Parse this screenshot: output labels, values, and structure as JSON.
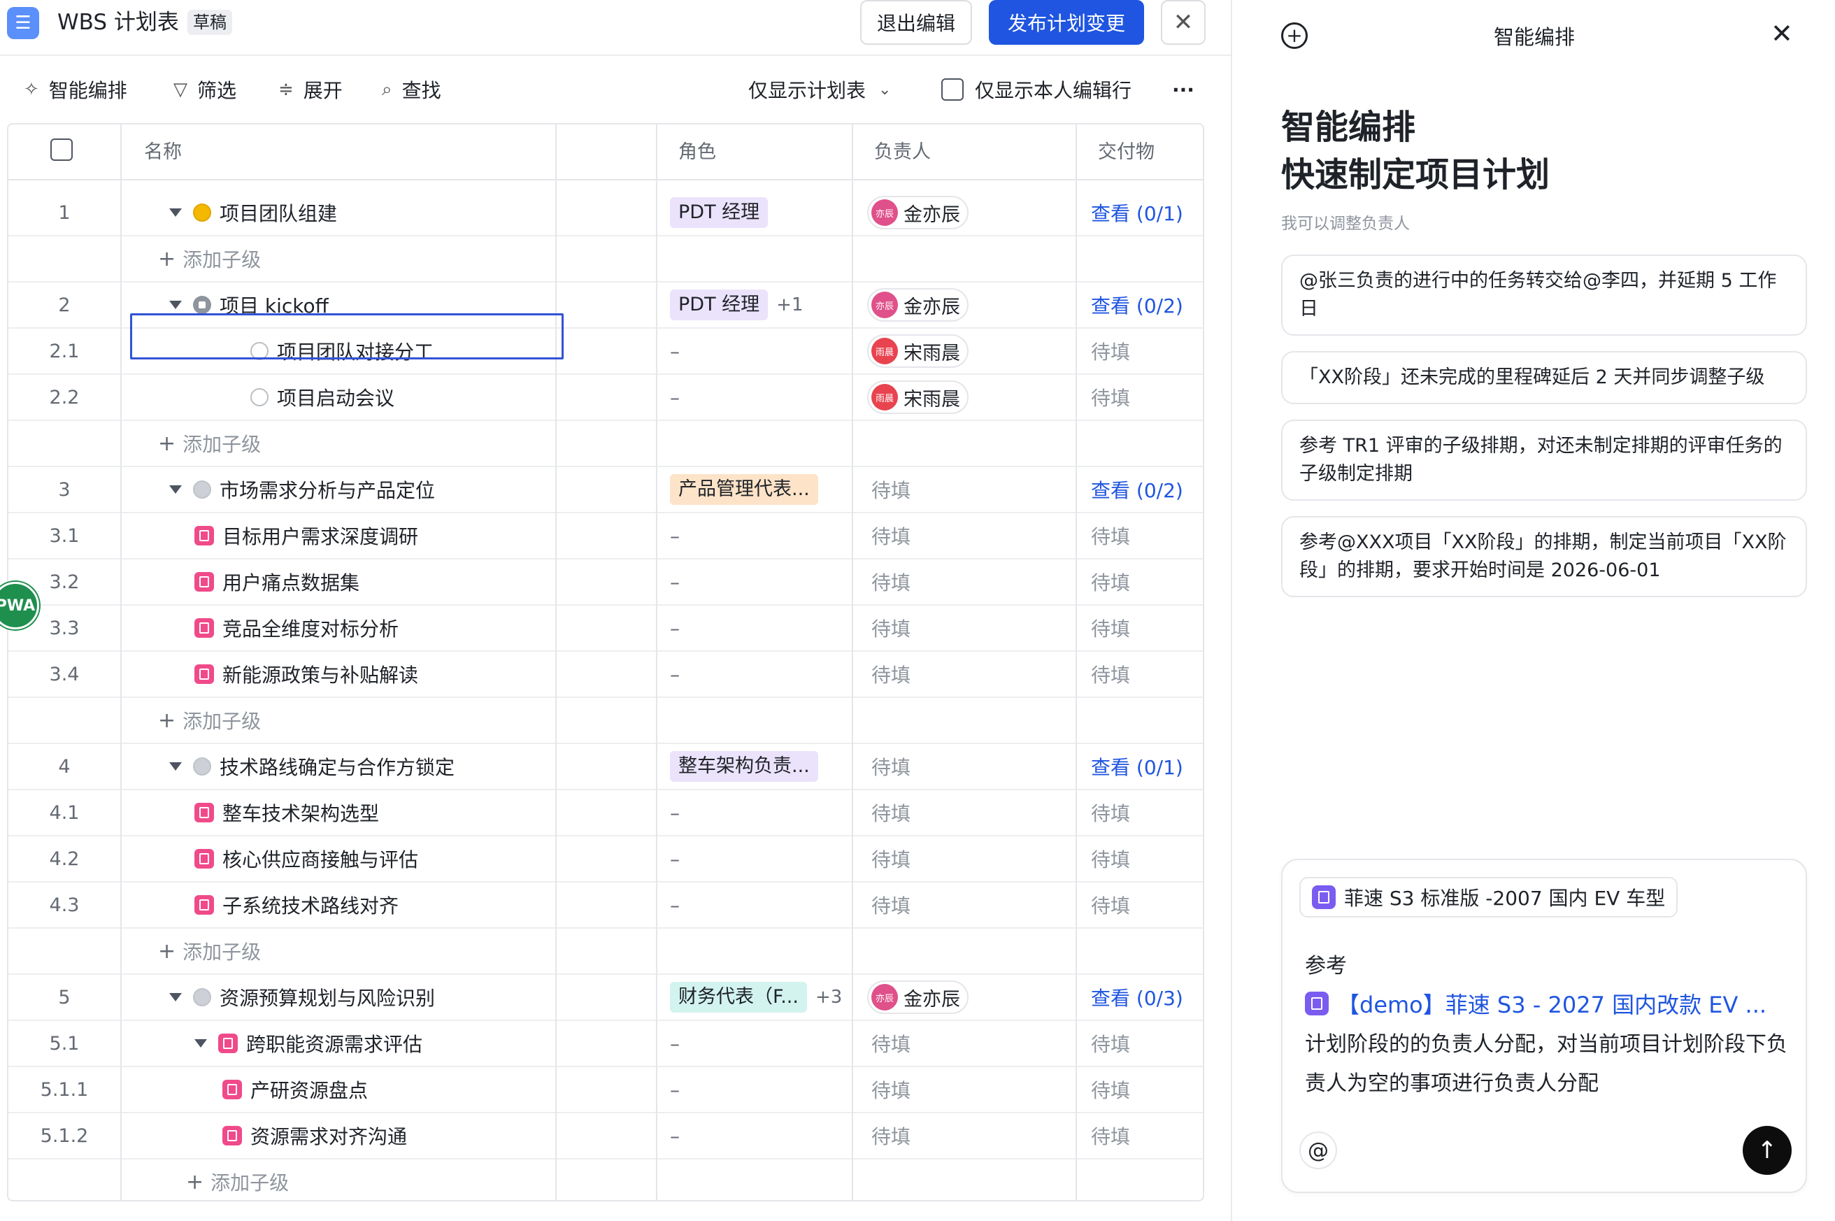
{
  "header": {
    "title": "WBS 计划表",
    "badge": "草稿",
    "exit_label": "退出编辑",
    "publish_label": "发布计划变更",
    "close_glyph": "✕"
  },
  "toolbar": {
    "smart": "智能编排",
    "filter": "筛选",
    "expand": "展开",
    "find": "查找",
    "plan_only": "仅显示计划表",
    "mine_only": "仅显示本人编辑行",
    "more": "···"
  },
  "columns": {
    "name": "名称",
    "role": "角色",
    "owner": "负责人",
    "deliverable": "交付物"
  },
  "add_child": "添加子级",
  "rows": [
    {
      "num": "1",
      "level": 0,
      "toggle": "down",
      "marker": "yellow",
      "name": "项目团队组建",
      "role": "PDT 经理",
      "role_color": "purple",
      "role_more": "",
      "owner": "金亦辰",
      "avatar": "亦辰",
      "deliv": "查看 (0/1)",
      "deliv_link": true
    },
    {
      "add": true,
      "indent": 1
    },
    {
      "num": "2",
      "level": 0,
      "toggle": "down",
      "marker": "flag",
      "name": "项目 kickoff",
      "role": "PDT 经理",
      "role_color": "purple",
      "role_more": "+1",
      "owner": "金亦辰",
      "avatar": "亦辰",
      "deliv": "查看 (0/2)",
      "deliv_link": true
    },
    {
      "num": "2.1",
      "level": 1,
      "toggle": "",
      "marker": "empty",
      "name": "项目团队对接分工",
      "role": "–",
      "owner": "宋雨晨",
      "avatar": "雨晨",
      "avatar_red": true,
      "deliv": "待填"
    },
    {
      "num": "2.2",
      "level": 1,
      "toggle": "",
      "marker": "empty",
      "name": "项目启动会议",
      "role": "–",
      "owner": "宋雨晨",
      "avatar": "雨晨",
      "avatar_red": true,
      "deliv": "待填"
    },
    {
      "add": true,
      "indent": 1
    },
    {
      "num": "3",
      "level": 0,
      "toggle": "down",
      "marker": "grey",
      "name": "市场需求分析与产品定位",
      "role": "产品管理代表...",
      "role_color": "orange",
      "role_more": "",
      "owner_text": "待填",
      "deliv": "查看 (0/2)",
      "deliv_link": true
    },
    {
      "num": "3.1",
      "level": 1,
      "toggle": "right",
      "marker": "bm",
      "name": "目标用户需求深度调研",
      "role": "–",
      "owner_text": "待填",
      "deliv": "待填"
    },
    {
      "num": "3.2",
      "level": 1,
      "toggle": "right",
      "marker": "bm",
      "name": "用户痛点数据集",
      "role": "–",
      "owner_text": "待填",
      "deliv": "待填"
    },
    {
      "num": "3.3",
      "level": 1,
      "toggle": "right",
      "marker": "bm",
      "name": "竞品全维度对标分析",
      "role": "–",
      "owner_text": "待填",
      "deliv": "待填"
    },
    {
      "num": "3.4",
      "level": 1,
      "toggle": "right",
      "marker": "bm",
      "name": "新能源政策与补贴解读",
      "role": "–",
      "owner_text": "待填",
      "deliv": "待填"
    },
    {
      "add": true,
      "indent": 1
    },
    {
      "num": "4",
      "level": 0,
      "toggle": "down",
      "marker": "grey",
      "name": "技术路线确定与合作方锁定",
      "role": "整车架构负责...",
      "role_color": "purple",
      "role_more": "",
      "owner_text": "待填",
      "deliv": "查看 (0/1)",
      "deliv_link": true
    },
    {
      "num": "4.1",
      "level": 1,
      "toggle": "right",
      "marker": "bm",
      "name": "整车技术架构选型",
      "role": "–",
      "owner_text": "待填",
      "deliv": "待填"
    },
    {
      "num": "4.2",
      "level": 1,
      "toggle": "right",
      "marker": "bm",
      "name": "核心供应商接触与评估",
      "role": "–",
      "owner_text": "待填",
      "deliv": "待填"
    },
    {
      "num": "4.3",
      "level": 1,
      "toggle": "right",
      "marker": "bm",
      "name": "子系统技术路线对齐",
      "role": "–",
      "owner_text": "待填",
      "deliv": "待填"
    },
    {
      "add": true,
      "indent": 1
    },
    {
      "num": "5",
      "level": 0,
      "toggle": "down",
      "marker": "grey",
      "name": "资源预算规划与风险识别",
      "role": "财务代表（F...",
      "role_color": "teal",
      "role_more": "+3",
      "owner": "金亦辰",
      "avatar": "亦辰",
      "deliv": "查看 (0/3)",
      "deliv_link": true
    },
    {
      "num": "5.1",
      "level": 1,
      "toggle": "down",
      "marker": "bm",
      "name": "跨职能资源需求评估",
      "role": "–",
      "owner_text": "待填",
      "deliv": "待填"
    },
    {
      "num": "5.1.1",
      "level": 2,
      "toggle": "right",
      "marker": "bm",
      "name": "产研资源盘点",
      "role": "–",
      "owner_text": "待填",
      "deliv": "待填"
    },
    {
      "num": "5.1.2",
      "level": 2,
      "toggle": "right",
      "marker": "bm",
      "name": "资源需求对齐沟通",
      "role": "–",
      "owner_text": "待填",
      "deliv": "待填"
    },
    {
      "add": true,
      "indent": 2
    }
  ],
  "floating_badge": "PWA",
  "panel": {
    "title": "智能编排",
    "hero_line1": "智能编排",
    "hero_line2": "快速制定项目计划",
    "hint": "我可以调整负责人",
    "suggestions": [
      "@张三负责的进行中的任务转交给@李四，并延期 5 工作日",
      "「XX阶段」还未完成的里程碑延后 2 天并同步调整子级",
      "参考 TR1 评审的子级排期，对还未制定排期的评审任务的子级制定排期",
      "参考@XXX项目「XX阶段」的排期，制定当前项目「XX阶段」的排期，要求开始时间是 2026-06-01"
    ],
    "composer": {
      "chip": "菲速 S3 标准版 -2007 国内 EV 车型",
      "ref_label": "参考",
      "ref_link": "【demo】菲速 S3 - 2027 国内改款 EV ...",
      "ref_text": "计划阶段的的负责人分配，对当前项目计划阶段下负责人为空的事项进行负责人分配",
      "at_glyph": "@",
      "send_glyph": "↑"
    }
  },
  "colors": {
    "primary": "#1f55e0",
    "tag_purple": "#ebe3fb",
    "tag_orange": "#fde3c8",
    "tag_teal": "#d3f3ee",
    "bookmark_pink": "#f04a8a",
    "status_yellow": "#f5b800"
  },
  "icons": {
    "app": "list-icon",
    "smart": "sparkle-icon",
    "filter": "funnel-icon",
    "expand": "expand-icon",
    "find": "search-icon",
    "dropdown": "chevron-down-icon",
    "panel_new": "plus-circle-icon",
    "panel_close": "close-icon"
  }
}
